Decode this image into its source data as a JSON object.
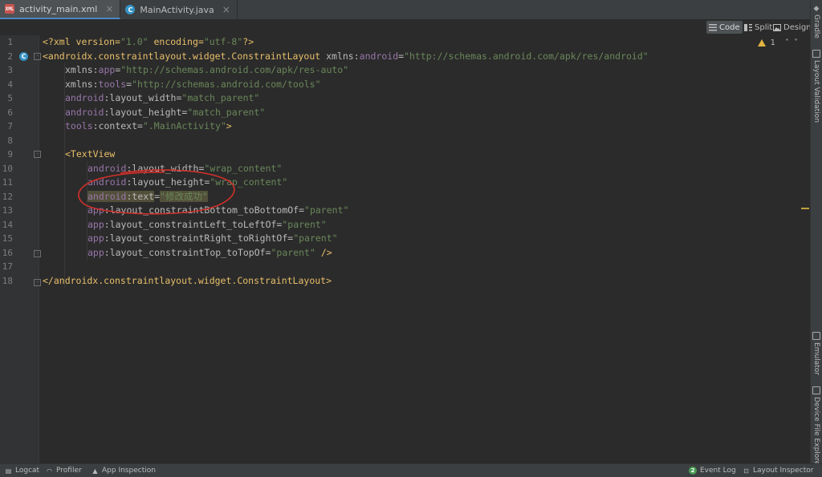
{
  "tabs": [
    {
      "label": "activity_main.xml",
      "close": "×",
      "active": true
    },
    {
      "label": "MainActivity.java",
      "close": "×",
      "active": false
    }
  ],
  "view_modes": {
    "code": "Code",
    "split": "Split",
    "design": "Design"
  },
  "problems": {
    "warning_count": "1",
    "up": "˄",
    "down": "˅"
  },
  "right_tools": {
    "gradle": "Gradle",
    "layout_validation": "Layout Validation",
    "emulator": "Emulator",
    "device_file_explorer": "Device File Explorer"
  },
  "gutter": {
    "lines": [
      "1",
      "2",
      "3",
      "4",
      "5",
      "6",
      "7",
      "8",
      "9",
      "10",
      "11",
      "12",
      "13",
      "14",
      "15",
      "16",
      "17",
      "18"
    ],
    "class_badge": "C"
  },
  "code": {
    "l1": {
      "a": "<?xml version=",
      "b": "\"1.0\"",
      "c": " encoding=",
      "d": "\"utf-8\"",
      "e": "?>"
    },
    "l2": {
      "a": "<androidx.constraintlayout.widget.ConstraintLayout ",
      "b": "xmlns:",
      "c": "android",
      "d": "=",
      "e": "\"http://schemas.android.com/apk/res/android\""
    },
    "l3": {
      "a": "xmlns:",
      "b": "app",
      "c": "=",
      "d": "\"http://schemas.android.com/apk/res-auto\""
    },
    "l4": {
      "a": "xmlns:",
      "b": "tools",
      "c": "=",
      "d": "\"http://schemas.android.com/tools\""
    },
    "l5": {
      "a": "android",
      "b": ":layout_width=",
      "c": "\"match_parent\""
    },
    "l6": {
      "a": "android",
      "b": ":layout_height=",
      "c": "\"match_parent\""
    },
    "l7": {
      "a": "tools",
      "b": ":context=",
      "c": "\".MainActivity\"",
      "d": ">"
    },
    "l9": {
      "a": "<TextView"
    },
    "l10": {
      "a": "android",
      "b": ":layout_width=",
      "c": "\"wrap_content\""
    },
    "l11": {
      "a": "android",
      "b": ":layout_height=",
      "c": "\"wrap_content\""
    },
    "l12": {
      "a": "android",
      "b": ":text",
      "c": "=",
      "d": "\"修改成功\""
    },
    "l13": {
      "a": "app",
      "b": ":layout_constraintBottom_toBottomOf=",
      "c": "\"parent\""
    },
    "l14": {
      "a": "app",
      "b": ":layout_constraintLeft_toLeftOf=",
      "c": "\"parent\""
    },
    "l15": {
      "a": "app",
      "b": ":layout_constraintRight_toRightOf=",
      "c": "\"parent\""
    },
    "l16": {
      "a": "app",
      "b": ":layout_constraintTop_toTopOf=",
      "c": "\"parent\"",
      "d": " />"
    },
    "l18": {
      "a": "</androidx.constraintlayout.widget.ConstraintLayout>"
    }
  },
  "status": {
    "logcat": "Logcat",
    "profiler": "Profiler",
    "app_inspection": "App Inspection",
    "event_log": "Event Log",
    "event_count": "2",
    "layout_inspector": "Layout Inspector"
  },
  "colors": {
    "annotation": "#d0302a",
    "accent": "#4a88c7"
  }
}
